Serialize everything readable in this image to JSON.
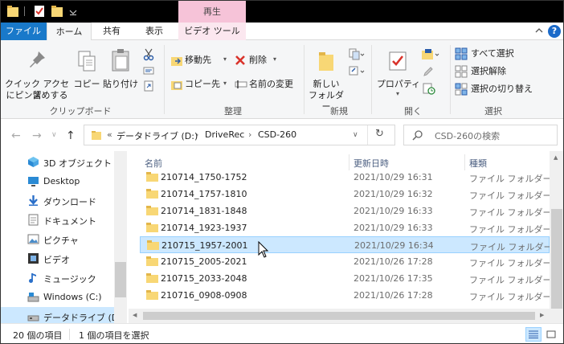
{
  "titlebar": {
    "context_tab_header": "再生"
  },
  "tabs": {
    "file": "ファイル",
    "home": "ホーム",
    "share": "共有",
    "view": "表示",
    "video_tools": "ビデオ ツール"
  },
  "ribbon": {
    "clipboard": {
      "pin_quick_access": "クイック アクセス\nにピン留めする",
      "pin_line1": "クイック アクセス",
      "pin_line2": "にピン留めする",
      "copy": "コピー",
      "paste": "貼り付け",
      "group_label": "クリップボード"
    },
    "organize": {
      "move_to": "移動先",
      "copy_to": "コピー先",
      "delete": "削除",
      "rename": "名前の変更",
      "group_label": "整理"
    },
    "new": {
      "new_folder_line1": "新しい",
      "new_folder_line2": "フォルダー",
      "group_label": "新規"
    },
    "open": {
      "properties": "プロパティ",
      "group_label": "開く"
    },
    "select": {
      "select_all": "すべて選択",
      "select_none": "選択解除",
      "invert_selection": "選択の切り替え",
      "group_label": "選択"
    }
  },
  "address": {
    "overflow": "«",
    "crumbs": [
      "データドライブ (D:)",
      "DriveRec",
      "CSD-260"
    ],
    "search_placeholder": "CSD-260の検索"
  },
  "nav": {
    "items": [
      {
        "label": "3D オブジェクト",
        "icon": "cube-icon"
      },
      {
        "label": "Desktop",
        "icon": "desktop-icon"
      },
      {
        "label": "ダウンロード",
        "icon": "download-icon"
      },
      {
        "label": "ドキュメント",
        "icon": "document-icon"
      },
      {
        "label": "ピクチャ",
        "icon": "picture-icon"
      },
      {
        "label": "ビデオ",
        "icon": "video-icon"
      },
      {
        "label": "ミュージック",
        "icon": "music-icon"
      },
      {
        "label": "Windows (C:)",
        "icon": "drive-icon"
      },
      {
        "label": "データドライブ (D:)",
        "icon": "drive-icon"
      }
    ]
  },
  "columns": {
    "name": "名前",
    "modified": "更新日時",
    "type": "種類"
  },
  "files": [
    {
      "name": "210714_1750-1752",
      "date": "2021/10/29 16:31",
      "type": "ファイル フォルダー"
    },
    {
      "name": "210714_1757-1810",
      "date": "2021/10/29 16:32",
      "type": "ファイル フォルダー"
    },
    {
      "name": "210714_1831-1848",
      "date": "2021/10/29 16:33",
      "type": "ファイル フォルダー"
    },
    {
      "name": "210714_1923-1937",
      "date": "2021/10/29 16:33",
      "type": "ファイル フォルダー"
    },
    {
      "name": "210715_1957-2001",
      "date": "2021/10/29 16:34",
      "type": "ファイル フォルダー"
    },
    {
      "name": "210715_2005-2021",
      "date": "2021/10/26 17:28",
      "type": "ファイル フォルダー"
    },
    {
      "name": "210715_2033-2048",
      "date": "2021/10/26 17:35",
      "type": "ファイル フォルダー"
    },
    {
      "name": "210716_0908-0908",
      "date": "2021/10/26 17:28",
      "type": "ファイル フォルダー"
    }
  ],
  "status": {
    "item_count": "20 個の項目",
    "selected": "1 個の項目を選択"
  },
  "colors": {
    "accent": "#1979ca",
    "selection": "#cce8ff",
    "context_tab": "#f6c3d8",
    "folder": "#f8d775"
  }
}
